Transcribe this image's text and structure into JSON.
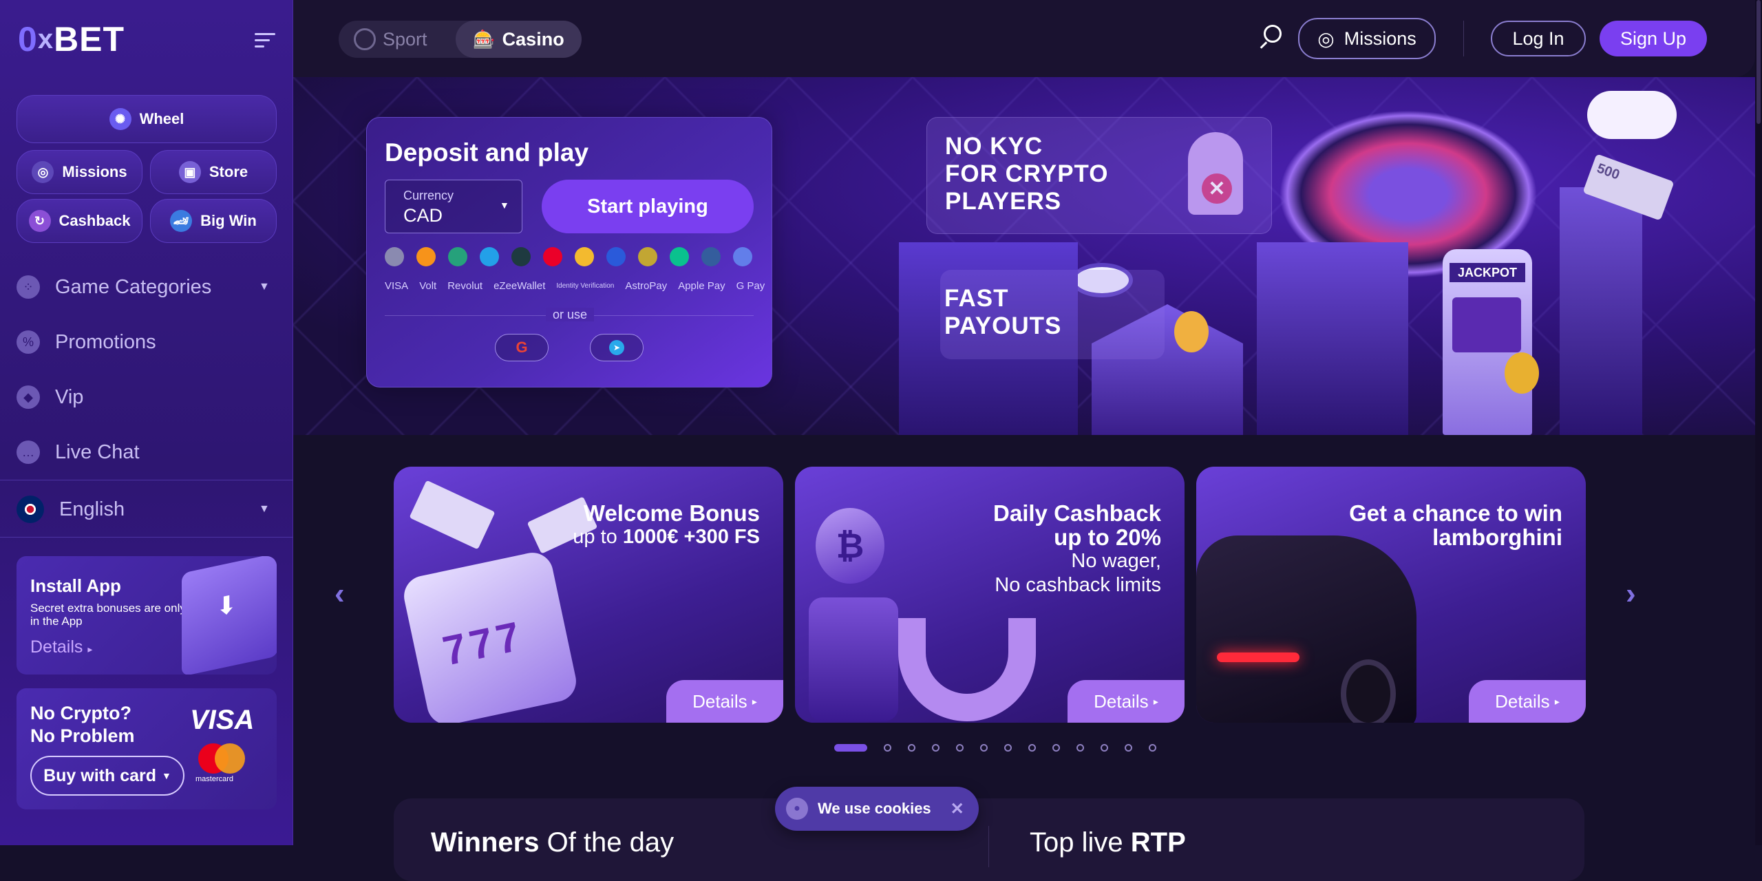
{
  "brand": {
    "zero": "0",
    "x": "x",
    "bet": "BET"
  },
  "sidebar": {
    "wheel": "Wheel",
    "missions": "Missions",
    "store": "Store",
    "cashback": "Cashback",
    "bigwin": "Big Win",
    "nav": [
      {
        "label": "Game Categories"
      },
      {
        "label": "Promotions"
      },
      {
        "label": "Vip"
      },
      {
        "label": "Live Chat"
      }
    ],
    "language": "English",
    "install": {
      "title": "Install App",
      "text": "Secret extra bonuses are only in the App",
      "details": "Details"
    },
    "crypto": {
      "line1": "No Crypto?",
      "line2": "No Problem",
      "button": "Buy with card",
      "visa": "VISA",
      "mastercard": "mastercard"
    }
  },
  "topbar": {
    "sport": "Sport",
    "casino": "Casino",
    "missions": "Missions",
    "login": "Log In",
    "signup": "Sign Up"
  },
  "deposit": {
    "title": "Deposit and play",
    "currency_label": "Currency",
    "currency_value": "CAD",
    "start": "Start playing",
    "or_use": "or use",
    "payment_methods": [
      "VISA",
      "Volt",
      "Revolut",
      "eZeeWallet",
      "Identity Verification",
      "AstroPay",
      "Apple Pay",
      "G Pay"
    ]
  },
  "hero": {
    "line1": "NO KYC",
    "line2": "FOR CRYPTO",
    "line3": "PLAYERS",
    "fast1": "FAST",
    "fast2": "PAYOUTS",
    "jackpot": "JACKPOT",
    "note": "500"
  },
  "promos": [
    {
      "title": "Welcome Bonus",
      "sub_a": "up to ",
      "sub_b": "1000€ +300 FS",
      "details": "Details"
    },
    {
      "title": "Daily Cashback",
      "title2": "up to 20%",
      "sub_a": "No wager,",
      "sub_b": "No cashback limits",
      "details": "Details"
    },
    {
      "title": "Get a chance to win",
      "title2": "lamborghini",
      "details": "Details"
    }
  ],
  "carousel": {
    "total_dots": 13,
    "active": 1
  },
  "cookie": {
    "text": "We use cookies"
  },
  "bottom": {
    "winners_a": "Winners",
    "winners_b": "Of the day",
    "rtp_a": "Top live",
    "rtp_b": "RTP"
  },
  "colors": {
    "accent": "#7a3ff0",
    "sidebar": "#3a1c8e",
    "topbar": "#1a1230"
  }
}
